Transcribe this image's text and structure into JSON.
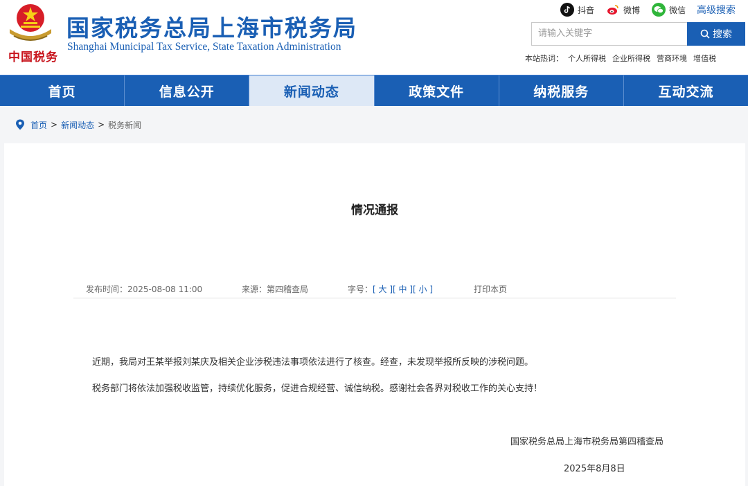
{
  "header": {
    "title": "国家税务总局上海市税务局",
    "subtitle": "Shanghai Municipal Tax Service, State Taxation Administration",
    "seal_text": "中国税务",
    "social": [
      {
        "label": "抖音",
        "icon": "douyin-icon",
        "color": "#111111"
      },
      {
        "label": "微博",
        "icon": "weibo-icon",
        "color": "#e6162d"
      },
      {
        "label": "微信",
        "icon": "wechat-icon",
        "color": "#2fb53a"
      }
    ],
    "advanced_search": "高级搜索",
    "search": {
      "placeholder": "请输入关键字",
      "button": "搜索"
    },
    "hotwords": {
      "label": "本站热词：",
      "items": [
        "个人所得税",
        "企业所得税",
        "营商环境",
        "增值税"
      ]
    }
  },
  "nav": {
    "items": [
      "首页",
      "信息公开",
      "新闻动态",
      "政策文件",
      "纳税服务",
      "互动交流"
    ],
    "active_index": 2
  },
  "breadcrumb": {
    "home": "首页",
    "section": "新闻动态",
    "current": "税务新闻",
    "separator": ">"
  },
  "article": {
    "title": "情况通报",
    "publish_label": "发布时间：",
    "publish_time": "2025-08-08 11:00",
    "source_label": "来源：",
    "source": "第四稽查局",
    "fontsize_label": "字号：",
    "fontsize_options": [
      "[ 大 ]",
      "[ 中 ]",
      "[ 小 ]"
    ],
    "print": "打印本页",
    "paragraphs": [
      "近期，我局对王某举报刘某庆及相关企业涉税违法事项依法进行了核查。经查，未发现举报所反映的涉税问题。",
      "税务部门将依法加强税收监管，持续优化服务，促进合规经营、诚信纳税。感谢社会各界对税收工作的关心支持！"
    ],
    "signature": "国家税务总局上海市税务局第四稽查局",
    "date": "2025年8月8日"
  },
  "colors": {
    "brand_blue": "#1a5fb4",
    "nav_active_bg": "#dde8f6",
    "seal_red": "#c8161e"
  }
}
